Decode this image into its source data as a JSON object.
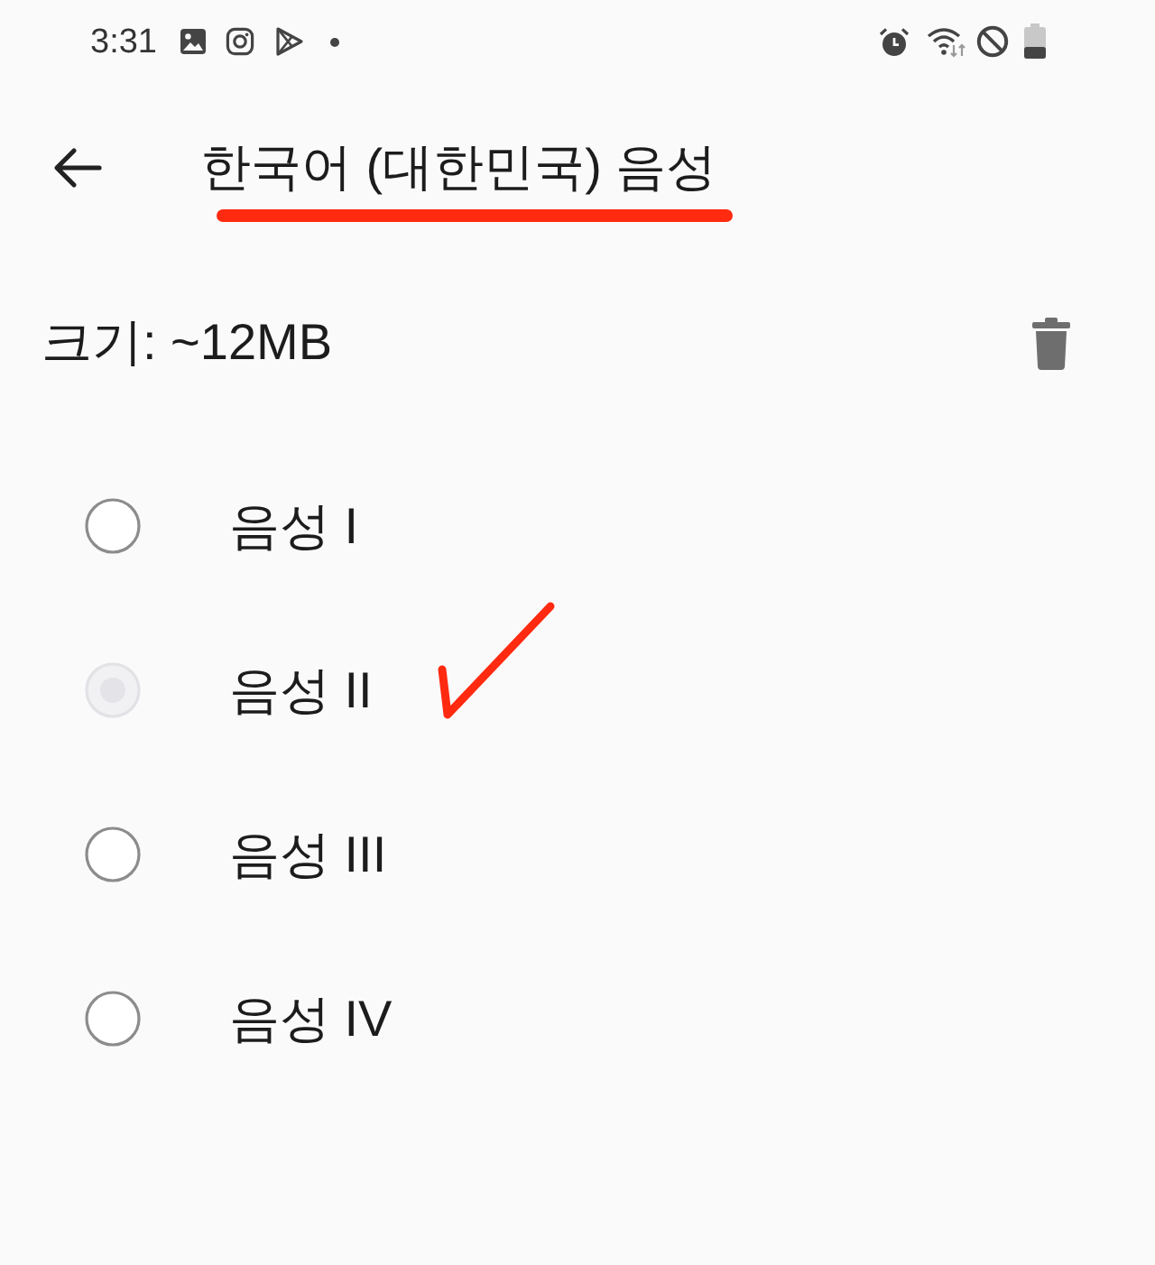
{
  "status_bar": {
    "time": "3:31"
  },
  "app_bar": {
    "title": "한국어 (대한민국) 음성",
    "underlined": true
  },
  "size_row": {
    "label": "크기: ~12MB"
  },
  "voices": [
    {
      "label": "음성 I",
      "selected": false,
      "hand_checkmark": false
    },
    {
      "label": "음성 II",
      "selected": true,
      "hand_checkmark": true
    },
    {
      "label": "음성 III",
      "selected": false,
      "hand_checkmark": false
    },
    {
      "label": "음성 IV",
      "selected": false,
      "hand_checkmark": false
    }
  ]
}
